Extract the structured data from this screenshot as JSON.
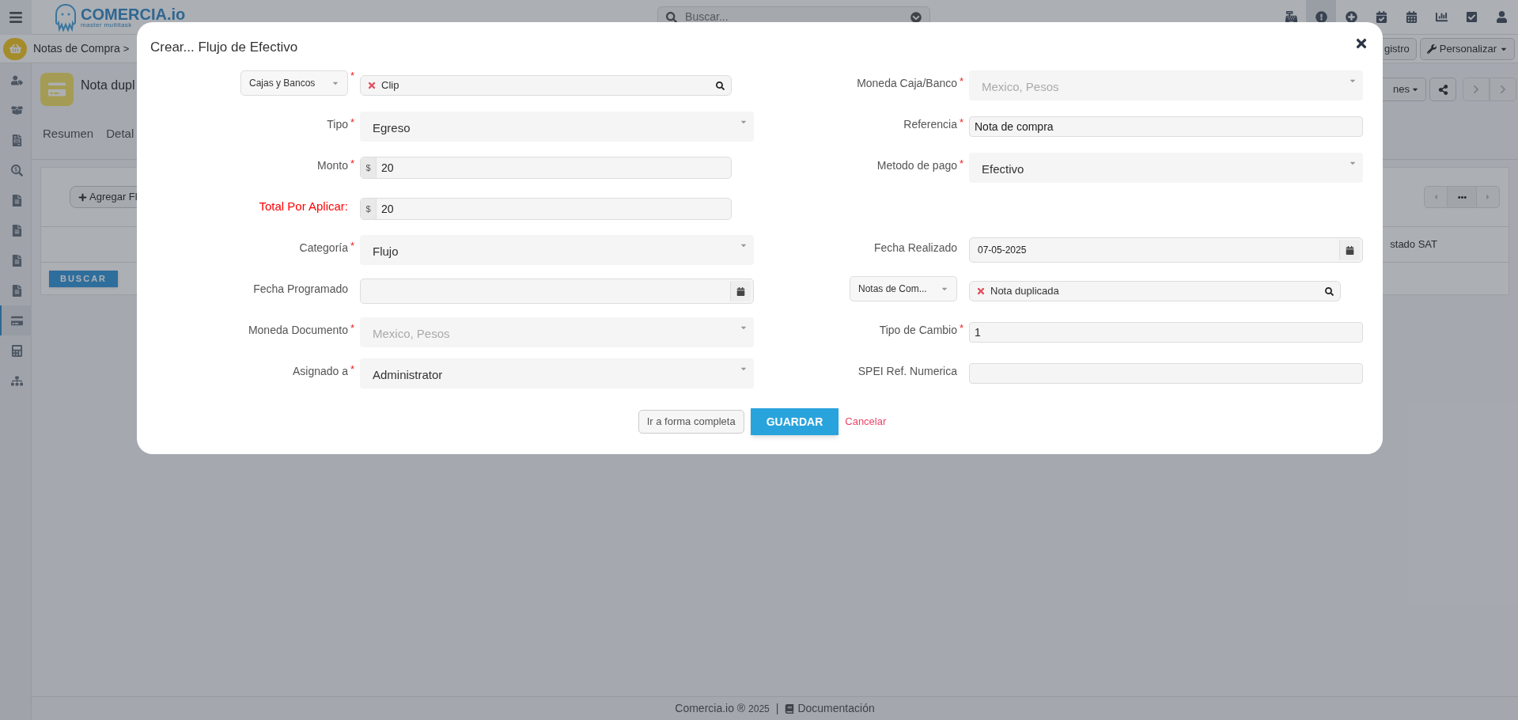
{
  "topbar": {
    "brand": "COMERCIA.io",
    "tagline": "master multitask",
    "search": {
      "placeholder": "Buscar..."
    },
    "icons": [
      {
        "selected": false
      },
      {
        "selected": true
      },
      {
        "selected": false
      },
      {
        "selected": false
      },
      {
        "selected": false
      },
      {
        "selected": false
      },
      {
        "selected": false
      },
      {
        "selected": false
      }
    ]
  },
  "breadcrumb": {
    "items": [
      "Notas de Compra"
    ],
    "separator": ">",
    "buttons": [
      "gistro",
      "Personalizar"
    ]
  },
  "sidebar": {
    "items": [
      {
        "selected": false
      },
      {
        "selected": false
      },
      {
        "selected": false
      },
      {
        "selected": false
      },
      {
        "selected": false
      },
      {
        "selected": false
      },
      {
        "selected": false
      },
      {
        "selected": false
      },
      {
        "selected": true
      },
      {
        "selected": false
      },
      {
        "selected": false
      }
    ]
  },
  "record": {
    "title": "Nota dupl",
    "actions_dropdown": "nes",
    "tabs": [
      {
        "label": "Resumen",
        "selected": false
      },
      {
        "label": "Detal",
        "selected": false
      }
    ]
  },
  "panel": {
    "add_button": "Agregar Fl",
    "column_header": "stado SAT",
    "search_button": "BUSCAR"
  },
  "footer": {
    "brand": "Comercia.io ®",
    "year": "2025",
    "separator": "|",
    "link": "Documentación"
  },
  "modal": {
    "title": "Crear... Flujo de Efectivo",
    "rows": [
      {
        "left": {
          "kind": "lookup",
          "selector": "Cajas y Bancos",
          "required_mark": "*",
          "value": "Clip"
        },
        "right": {
          "kind": "select",
          "label": "Moneda Caja/Banco",
          "required_mark": "*",
          "value": "Mexico, Pesos",
          "disabled": true
        }
      },
      {
        "left": {
          "kind": "select",
          "label": "Tipo",
          "required_mark": "*",
          "value": "Egreso",
          "disabled": false
        },
        "right": {
          "kind": "text",
          "label": "Referencia",
          "required_mark": "*",
          "value": "Nota de compra"
        }
      },
      {
        "left": {
          "kind": "money",
          "label": "Monto",
          "required_mark": "*",
          "prefix": "$",
          "value": "20",
          "highlight": false
        },
        "right": {
          "kind": "select",
          "label": "Metodo de pago",
          "required_mark": "*",
          "value": "Efectivo",
          "disabled": false
        }
      },
      {
        "left": {
          "kind": "money",
          "label": "Total Por Aplicar:",
          "prefix": "$",
          "value": "20",
          "highlight": true
        }
      },
      {
        "left": {
          "kind": "select",
          "label": "Categoría",
          "required_mark": "*",
          "value": "Flujo",
          "disabled": false
        },
        "right": {
          "kind": "date",
          "label": "Fecha Realizado",
          "value": "07-05-2025"
        }
      },
      {
        "left": {
          "kind": "date",
          "label": "Fecha Programado"
        },
        "right": {
          "kind": "lookup",
          "selector": "Notas de Com...",
          "value": "Nota duplicada"
        }
      },
      {
        "left": {
          "kind": "select",
          "label": "Moneda Documento",
          "required_mark": "*",
          "value": "Mexico, Pesos",
          "disabled": true
        },
        "right": {
          "kind": "text",
          "label": "Tipo de Cambio",
          "required_mark": "*",
          "value": "1"
        }
      },
      {
        "left": {
          "kind": "select",
          "label": "Asignado a",
          "required_mark": "*",
          "value": "Administrator",
          "disabled": false
        },
        "right": {
          "kind": "text",
          "label": "SPEI Ref. Numerica"
        }
      }
    ],
    "buttons": [
      {
        "kind": "secondary",
        "label": "Ir a forma completa"
      },
      {
        "kind": "primary",
        "label": "GUARDAR"
      },
      {
        "kind": "link",
        "label": "Cancelar"
      }
    ]
  }
}
